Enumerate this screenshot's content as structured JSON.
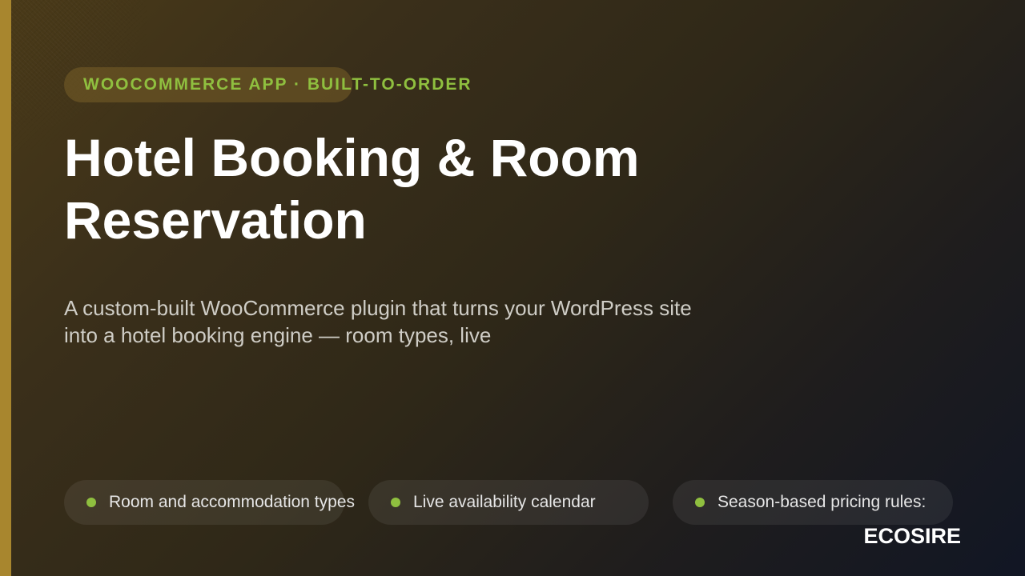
{
  "badge": {
    "label": "WOOCOMMERCE APP · BUILT-TO-ORDER"
  },
  "headline": {
    "title": "Hotel Booking & Room Reservation"
  },
  "description": "A custom-built WooCommerce plugin that turns your WordPress site into a hotel booking engine — room types, live",
  "features": [
    {
      "label": "Room and accommodation types"
    },
    {
      "label": "Live availability calendar"
    },
    {
      "label": "Season-based pricing rules:"
    }
  ],
  "brand": "ECOSIRE",
  "colors": {
    "accent_bar": "#a8862e",
    "badge_text": "#8fbf3f",
    "bullet": "#8fbf3f"
  }
}
